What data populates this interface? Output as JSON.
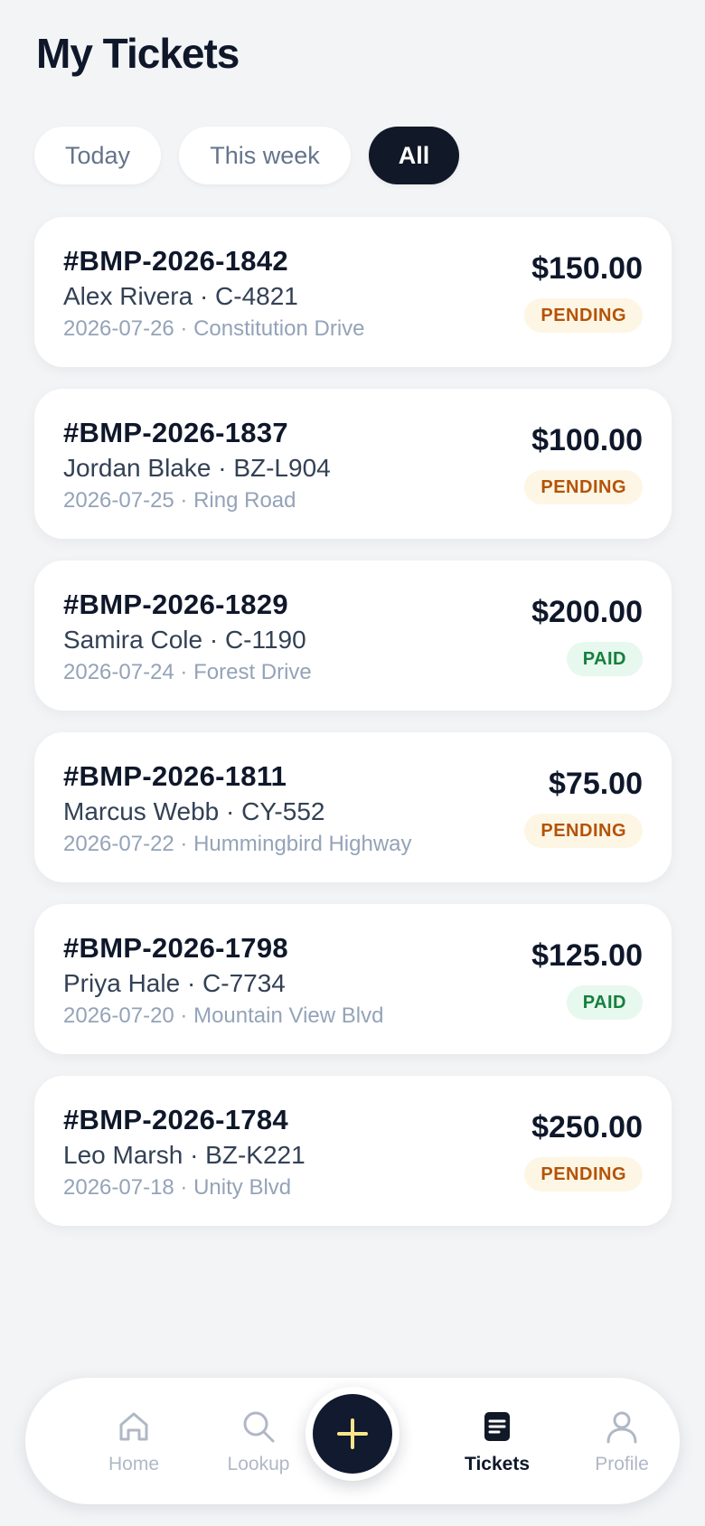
{
  "header": {
    "title": "My Tickets"
  },
  "filters": {
    "today": "Today",
    "week": "This week",
    "all": "All",
    "selected": "All"
  },
  "tickets": [
    {
      "id": "#BMP-2026-1842",
      "person": "Alex Rivera · C-4821",
      "meta": "2026-07-26 · Constitution Drive",
      "amount": "$150.00",
      "status": "PENDING"
    },
    {
      "id": "#BMP-2026-1837",
      "person": "Jordan Blake · BZ-L904",
      "meta": "2026-07-25 · Ring Road",
      "amount": "$100.00",
      "status": "PENDING"
    },
    {
      "id": "#BMP-2026-1829",
      "person": "Samira Cole · C-1190",
      "meta": "2026-07-24 · Forest Drive",
      "amount": "$200.00",
      "status": "PAID"
    },
    {
      "id": "#BMP-2026-1811",
      "person": "Marcus Webb · CY-552",
      "meta": "2026-07-22 · Hummingbird Highway",
      "amount": "$75.00",
      "status": "PENDING"
    },
    {
      "id": "#BMP-2026-1798",
      "person": "Priya Hale · C-7734",
      "meta": "2026-07-20 · Mountain View Blvd",
      "amount": "$125.00",
      "status": "PAID"
    },
    {
      "id": "#BMP-2026-1784",
      "person": "Leo Marsh · BZ-K221",
      "meta": "2026-07-18 · Unity Blvd",
      "amount": "$250.00",
      "status": "PENDING"
    }
  ],
  "nav": {
    "home": "Home",
    "lookup": "Lookup",
    "tickets": "Tickets",
    "profile": "Profile",
    "active": "Tickets",
    "add_icon": "plus-icon"
  },
  "colors": {
    "primary": "#111827",
    "pending_text": "#b45309",
    "pending_bg": "#fef6e4",
    "paid_text": "#15803d",
    "paid_bg": "#e7f8ee",
    "fab_plus": "#fde68a"
  }
}
